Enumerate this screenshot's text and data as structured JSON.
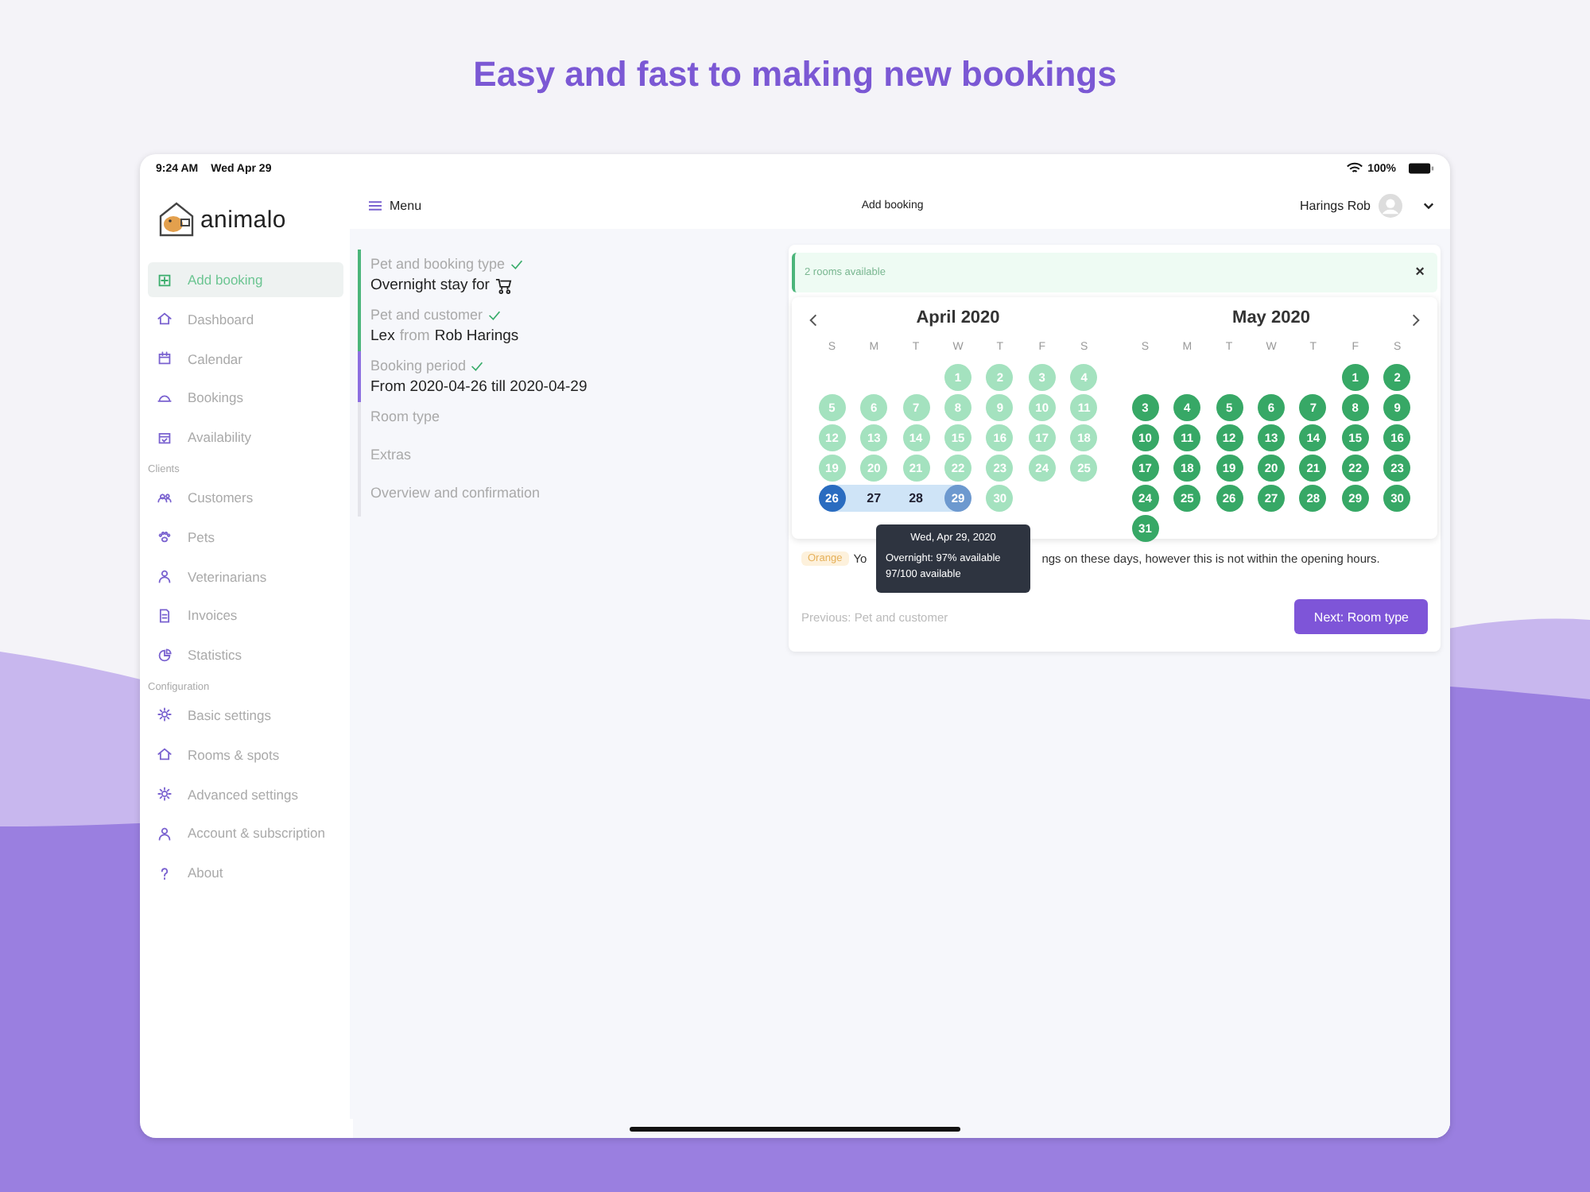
{
  "headline": "Easy and fast to making new bookings",
  "status_bar": {
    "time": "9:24 AM",
    "date": "Wed Apr 29",
    "battery": "100%"
  },
  "header": {
    "menu": "Menu",
    "title": "Add booking",
    "user": "Harings Rob"
  },
  "logo": "animalo",
  "sidebar": [
    {
      "items": [
        {
          "label": "Add booking",
          "selected": true
        },
        {
          "label": "Dashboard",
          "selected": false
        },
        {
          "label": "Calendar",
          "selected": false
        },
        {
          "label": "Bookings",
          "selected": false
        },
        {
          "label": "Availability",
          "selected": false
        }
      ]
    },
    {
      "heading": "Clients",
      "items": [
        {
          "label": "Customers",
          "selected": false
        },
        {
          "label": "Pets",
          "selected": false
        },
        {
          "label": "Veterinarians",
          "selected": false
        },
        {
          "label": "Invoices",
          "selected": false
        },
        {
          "label": "Statistics",
          "selected": false
        }
      ]
    },
    {
      "heading": "Configuration",
      "items": [
        {
          "label": "Basic settings",
          "selected": false
        },
        {
          "label": "Rooms & spots",
          "selected": false
        },
        {
          "label": "Advanced settings",
          "selected": false
        },
        {
          "label": "Account & subscription",
          "selected": false
        },
        {
          "label": "About",
          "selected": false
        }
      ]
    }
  ],
  "steps": [
    {
      "title": "Pet and booking type",
      "checked": true,
      "kind": "done",
      "value": [
        {
          "text": "Overnight stay for",
          "muted": false
        }
      ],
      "value_icon": true
    },
    {
      "title": "Pet and customer",
      "checked": true,
      "kind": "done",
      "value": [
        {
          "text": "Lex",
          "muted": false
        },
        {
          "text": "from",
          "muted": true
        },
        {
          "text": "Rob Harings",
          "muted": false
        }
      ]
    },
    {
      "title": "Booking period",
      "checked": true,
      "kind": "current",
      "value": [
        {
          "text": "From 2020-04-26 till 2020-04-29",
          "muted": false
        }
      ]
    },
    {
      "title": "Room type",
      "checked": false,
      "kind": "todo"
    },
    {
      "title": "Extras",
      "checked": false,
      "kind": "todo"
    },
    {
      "title": "Overview and confirmation",
      "checked": false,
      "kind": "todo"
    }
  ],
  "alert": {
    "text": "2 rooms available",
    "close": "×"
  },
  "months": [
    {
      "title": "April 2020",
      "weekdays": [
        "S",
        "M",
        "T",
        "W",
        "T",
        "F",
        "S"
      ],
      "weeks": [
        [
          {
            "kind": "blank"
          },
          {
            "kind": "blank"
          },
          {
            "kind": "blank"
          },
          {
            "day": "1",
            "kind": "past"
          },
          {
            "day": "2",
            "kind": "past"
          },
          {
            "day": "3",
            "kind": "past"
          },
          {
            "day": "4",
            "kind": "past"
          }
        ],
        [
          {
            "day": "5",
            "kind": "past"
          },
          {
            "day": "6",
            "kind": "past"
          },
          {
            "day": "7",
            "kind": "past"
          },
          {
            "day": "8",
            "kind": "past"
          },
          {
            "day": "9",
            "kind": "past"
          },
          {
            "day": "10",
            "kind": "past"
          },
          {
            "day": "11",
            "kind": "past"
          }
        ],
        [
          {
            "day": "12",
            "kind": "past"
          },
          {
            "day": "13",
            "kind": "past"
          },
          {
            "day": "14",
            "kind": "past"
          },
          {
            "day": "15",
            "kind": "past"
          },
          {
            "day": "16",
            "kind": "past"
          },
          {
            "day": "17",
            "kind": "past"
          },
          {
            "day": "18",
            "kind": "past"
          }
        ],
        [
          {
            "day": "19",
            "kind": "past"
          },
          {
            "day": "20",
            "kind": "past"
          },
          {
            "day": "21",
            "kind": "past"
          },
          {
            "day": "22",
            "kind": "past"
          },
          {
            "day": "23",
            "kind": "past"
          },
          {
            "day": "24",
            "kind": "past"
          },
          {
            "day": "25",
            "kind": "past"
          }
        ],
        [
          {
            "day": "26",
            "kind": "start"
          },
          {
            "day": "27",
            "kind": "range"
          },
          {
            "day": "28",
            "kind": "range"
          },
          {
            "day": "29",
            "kind": "end"
          },
          {
            "day": "30",
            "kind": "past"
          }
        ]
      ]
    },
    {
      "title": "May 2020",
      "weekdays": [
        "S",
        "M",
        "T",
        "W",
        "T",
        "F",
        "S"
      ],
      "weeks": [
        [
          {
            "kind": "blank"
          },
          {
            "kind": "blank"
          },
          {
            "kind": "blank"
          },
          {
            "kind": "blank"
          },
          {
            "kind": "blank"
          },
          {
            "day": "1",
            "kind": "available"
          },
          {
            "day": "2",
            "kind": "available"
          }
        ],
        [
          {
            "day": "3",
            "kind": "available"
          },
          {
            "day": "4",
            "kind": "available"
          },
          {
            "day": "5",
            "kind": "available"
          },
          {
            "day": "6",
            "kind": "available"
          },
          {
            "day": "7",
            "kind": "available"
          },
          {
            "day": "8",
            "kind": "available"
          },
          {
            "day": "9",
            "kind": "available"
          }
        ],
        [
          {
            "day": "10",
            "kind": "available"
          },
          {
            "day": "11",
            "kind": "available"
          },
          {
            "day": "12",
            "kind": "available"
          },
          {
            "day": "13",
            "kind": "available"
          },
          {
            "day": "14",
            "kind": "available"
          },
          {
            "day": "15",
            "kind": "available"
          },
          {
            "day": "16",
            "kind": "available"
          }
        ],
        [
          {
            "day": "17",
            "kind": "available"
          },
          {
            "day": "18",
            "kind": "available"
          },
          {
            "day": "19",
            "kind": "available"
          },
          {
            "day": "20",
            "kind": "available"
          },
          {
            "day": "21",
            "kind": "available"
          },
          {
            "day": "22",
            "kind": "available"
          },
          {
            "day": "23",
            "kind": "available"
          }
        ],
        [
          {
            "day": "24",
            "kind": "available"
          },
          {
            "day": "25",
            "kind": "available"
          },
          {
            "day": "26",
            "kind": "available"
          },
          {
            "day": "27",
            "kind": "available"
          },
          {
            "day": "28",
            "kind": "available"
          },
          {
            "day": "29",
            "kind": "available"
          },
          {
            "day": "30",
            "kind": "available"
          }
        ],
        [
          {
            "day": "31",
            "kind": "available"
          }
        ]
      ]
    }
  ],
  "tooltip": {
    "title": "Wed, Apr 29, 2020",
    "lines": [
      "Overnight: 97% available",
      "97/100 available"
    ]
  },
  "legend": {
    "badge": "Orange",
    "text_before": "Yo",
    "text_after": "ngs on these days, however this is not within the opening hours."
  },
  "footer": {
    "previous": "Previous: Pet and customer",
    "next": "Next: Room type"
  }
}
